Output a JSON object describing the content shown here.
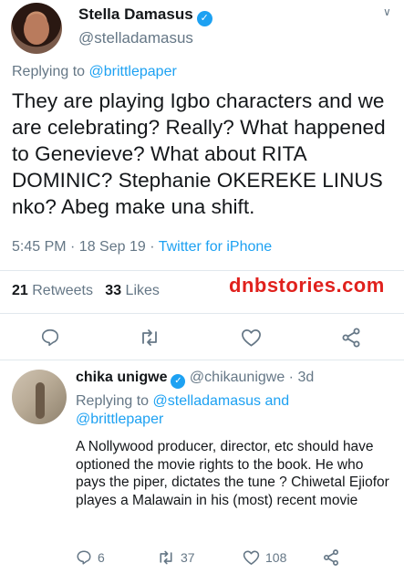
{
  "main_tweet": {
    "author_name": "Stella Damasus",
    "verified_glyph": "✓",
    "author_handle": "@stelladamasus",
    "menu_glyph": "∨",
    "replying_prefix": "Replying to",
    "replying_handle": "@brittlepaper",
    "text": "They are playing Igbo characters and we are celebrating? Really? What happened to Genevieve? What about RITA DOMINIC? Stephanie OKEREKE LINUS nko? Abeg make una shift.",
    "timestamp": "5:45 PM · 18 Sep 19 · ",
    "source": "Twitter for iPhone",
    "retweets_count": "21",
    "retweets_label": "Retweets",
    "likes_count": "33",
    "likes_label": "Likes"
  },
  "watermark": "dnbstories.com",
  "reply_tweet": {
    "author_name": "chika unigwe",
    "verified_glyph": "✓",
    "author_handle_time": "@chikaunigwe · 3d",
    "replying_prefix": "Replying to",
    "replying_handles": "@stelladamasus and @brittlepaper",
    "text": "A Nollywood producer, director, etc should have optioned the movie rights to the book. He who pays the piper, dictates the tune ? Chiwetal Ejiofor playes a Malawain in his (most) recent movie",
    "reply_count": "6",
    "retweet_count": "37",
    "like_count": "108"
  },
  "colors": {
    "accent": "#1da1f2",
    "secondary_text": "#657786",
    "primary_text": "#14171a",
    "watermark": "#e0211d",
    "divider": "#e1e8ed"
  },
  "icons": {
    "reply": "reply-icon",
    "retweet": "retweet-icon",
    "like": "heart-icon",
    "share": "share-icon"
  }
}
